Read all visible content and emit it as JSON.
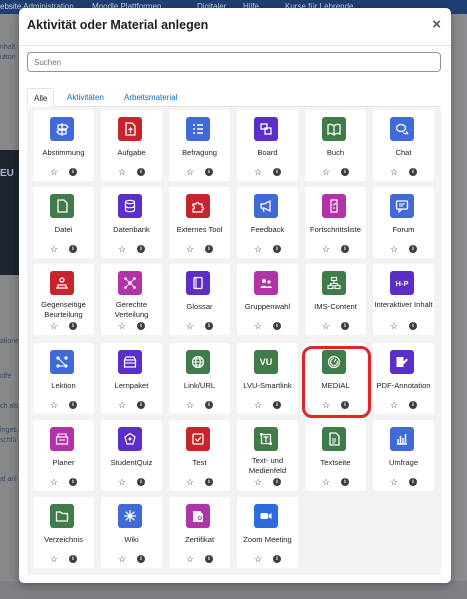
{
  "background": {
    "topbar_items": [
      "ebsite Administration",
      "Moodle Plattformen",
      "Digitaler",
      "Hilfe",
      "Kurse für Lehrende"
    ],
    "left_texts": [
      "nhalt",
      "utton",
      "EU",
      "ationen",
      "offe",
      "ch als",
      "ingeti,",
      "schlü",
      "al anl"
    ]
  },
  "modal": {
    "title": "Aktivität oder Material anlegen",
    "close_label": "×",
    "search_placeholder": "Suchen",
    "tabs": [
      {
        "label": "Alle",
        "active": true
      },
      {
        "label": "Aktivitäten",
        "active": false
      },
      {
        "label": "Arbeitsmaterial",
        "active": false
      }
    ],
    "star_symbol": "☆",
    "info_symbol": "i",
    "items": [
      {
        "label": "Abstimmung",
        "icon": "signpost-icon",
        "color": "#3f6ad8"
      },
      {
        "label": "Aufgabe",
        "icon": "upload-document-icon",
        "color": "#c7252d"
      },
      {
        "label": "Befragung",
        "icon": "checklist-icon",
        "color": "#3f6ad8"
      },
      {
        "label": "Board",
        "icon": "board-icon",
        "color": "#5b2ec7"
      },
      {
        "label": "Buch",
        "icon": "book-icon",
        "color": "#3f7c4a"
      },
      {
        "label": "Chat",
        "icon": "chat-icon",
        "color": "#3f6ad8"
      },
      {
        "label": "Datei",
        "icon": "file-icon",
        "color": "#3f7c4a"
      },
      {
        "label": "Datenbank",
        "icon": "database-icon",
        "color": "#5b2ec7"
      },
      {
        "label": "Externes Tool",
        "icon": "puzzle-icon",
        "color": "#c7252d"
      },
      {
        "label": "Feedback",
        "icon": "megaphone-icon",
        "color": "#3f6ad8"
      },
      {
        "label": "Fortschrittsliste",
        "icon": "progress-list-icon",
        "color": "#b233a8"
      },
      {
        "label": "Forum",
        "icon": "forum-icon",
        "color": "#3f6ad8"
      },
      {
        "label": "Gegenseitige Beurteilung",
        "icon": "peer-review-icon",
        "color": "#c7252d"
      },
      {
        "label": "Gerechte Verteilung",
        "icon": "distribution-icon",
        "color": "#b233a8"
      },
      {
        "label": "Glossar",
        "icon": "glossary-icon",
        "color": "#5b2ec7"
      },
      {
        "label": "Gruppenwahl",
        "icon": "group-icon",
        "color": "#b233a8"
      },
      {
        "label": "IMS-Content",
        "icon": "ims-content-icon",
        "color": "#3f7c4a"
      },
      {
        "label": "Interaktiver Inhalt",
        "icon": "h5p-icon",
        "color": "#5b2ec7",
        "icon_text": "H-P"
      },
      {
        "label": "Lektion",
        "icon": "lesson-icon",
        "color": "#3f6ad8"
      },
      {
        "label": "Lernpaket",
        "icon": "package-icon",
        "color": "#5b2ec7"
      },
      {
        "label": "Link/URL",
        "icon": "globe-icon",
        "color": "#3f7c4a"
      },
      {
        "label": "LVU-Smartlink",
        "icon": "vu-icon",
        "color": "#3f7c4a",
        "icon_text": "VU"
      },
      {
        "label": "MEDIAL",
        "icon": "medial-icon",
        "color": "#3f7c4a"
      },
      {
        "label": "PDF-Annotation",
        "icon": "pdf-annotation-icon",
        "color": "#5b2ec7"
      },
      {
        "label": "Planer",
        "icon": "planner-icon",
        "color": "#b233a8"
      },
      {
        "label": "StudentQuiz",
        "icon": "studentquiz-icon",
        "color": "#5b2ec7"
      },
      {
        "label": "Test",
        "icon": "test-icon",
        "color": "#c7252d"
      },
      {
        "label": "Text- und Medienfeld",
        "icon": "text-media-icon",
        "color": "#3f7c4a"
      },
      {
        "label": "Textseite",
        "icon": "page-icon",
        "color": "#3f7c4a"
      },
      {
        "label": "Umfrage",
        "icon": "bar-chart-icon",
        "color": "#3f6ad8"
      },
      {
        "label": "Verzeichnis",
        "icon": "folder-icon",
        "color": "#3f7c4a"
      },
      {
        "label": "Wiki",
        "icon": "wiki-icon",
        "color": "#3f6ad8"
      },
      {
        "label": "Zertifikat",
        "icon": "certificate-icon",
        "color": "#b233a8"
      },
      {
        "label": "Zoom Meeting",
        "icon": "zoom-icon",
        "color": "#2d6cdf"
      }
    ]
  }
}
